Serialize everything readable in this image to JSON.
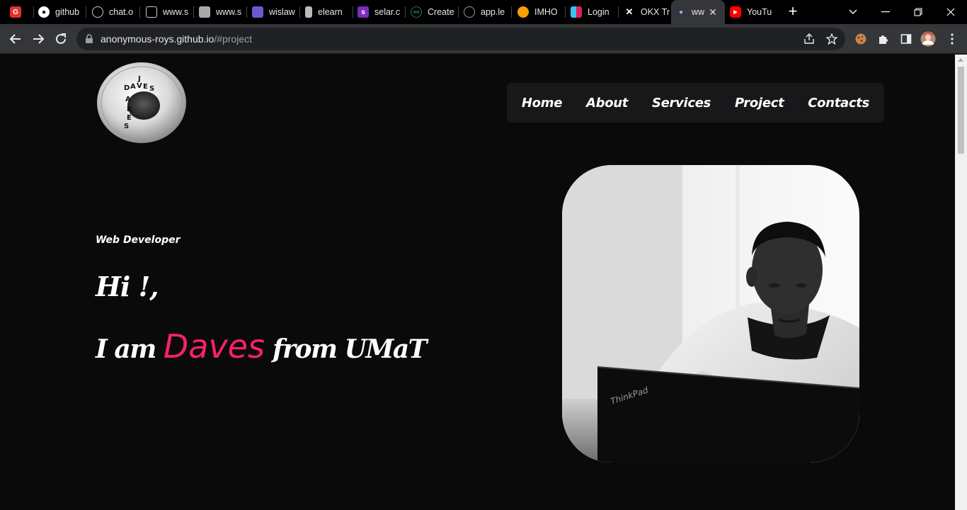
{
  "browser": {
    "tabs": [
      {
        "label": "",
        "icon": "app-red-icon",
        "color": "#e03131"
      },
      {
        "label": "github",
        "icon": "github-icon",
        "color": "#ffffff"
      },
      {
        "label": "chat.o",
        "icon": "openai-icon",
        "color": "#cccccc"
      },
      {
        "label": "www.s",
        "icon": "cube-outline-icon",
        "color": "#cccccc"
      },
      {
        "label": "www.s",
        "icon": "cube-icon",
        "color": "#aaaaaa"
      },
      {
        "label": "wislaw",
        "icon": "wislaw-icon",
        "color": "#6a5acd"
      },
      {
        "label": "elearn",
        "icon": "page-icon",
        "color": "#bbbbbb"
      },
      {
        "label": "selar.c",
        "icon": "selar-icon",
        "color": "#7b2cbf"
      },
      {
        "label": "Create",
        "icon": "wa-icon",
        "color": "#1c7c54"
      },
      {
        "label": "app.le",
        "icon": "app-le-icon",
        "color": "#999999"
      },
      {
        "label": "IMHO",
        "icon": "imho-icon",
        "color": "#f59f00"
      },
      {
        "label": "Login",
        "icon": "slack-icon",
        "color": "#e01e5a"
      },
      {
        "label": "OKX Tr",
        "icon": "okx-icon",
        "color": "#ffffff"
      },
      {
        "label": "ww",
        "icon": "page-icon",
        "color": "#8ab4f8",
        "active": true
      },
      {
        "label": "YouTu",
        "icon": "youtube-icon",
        "color": "#ff0000"
      }
    ],
    "url_host": "anonymous-roys.github.io",
    "url_path": "/#project"
  },
  "site": {
    "logo_text": "DAVES JAKES",
    "nav": [
      "Home",
      "About",
      "Services",
      "Project",
      "Contacts"
    ],
    "role": "Web Developer",
    "greeting": "Hi !,",
    "intro_prefix": "I am",
    "intro_name": "Daves",
    "intro_suffix": "from UMaT",
    "accent_color": "#ff1f6b"
  }
}
